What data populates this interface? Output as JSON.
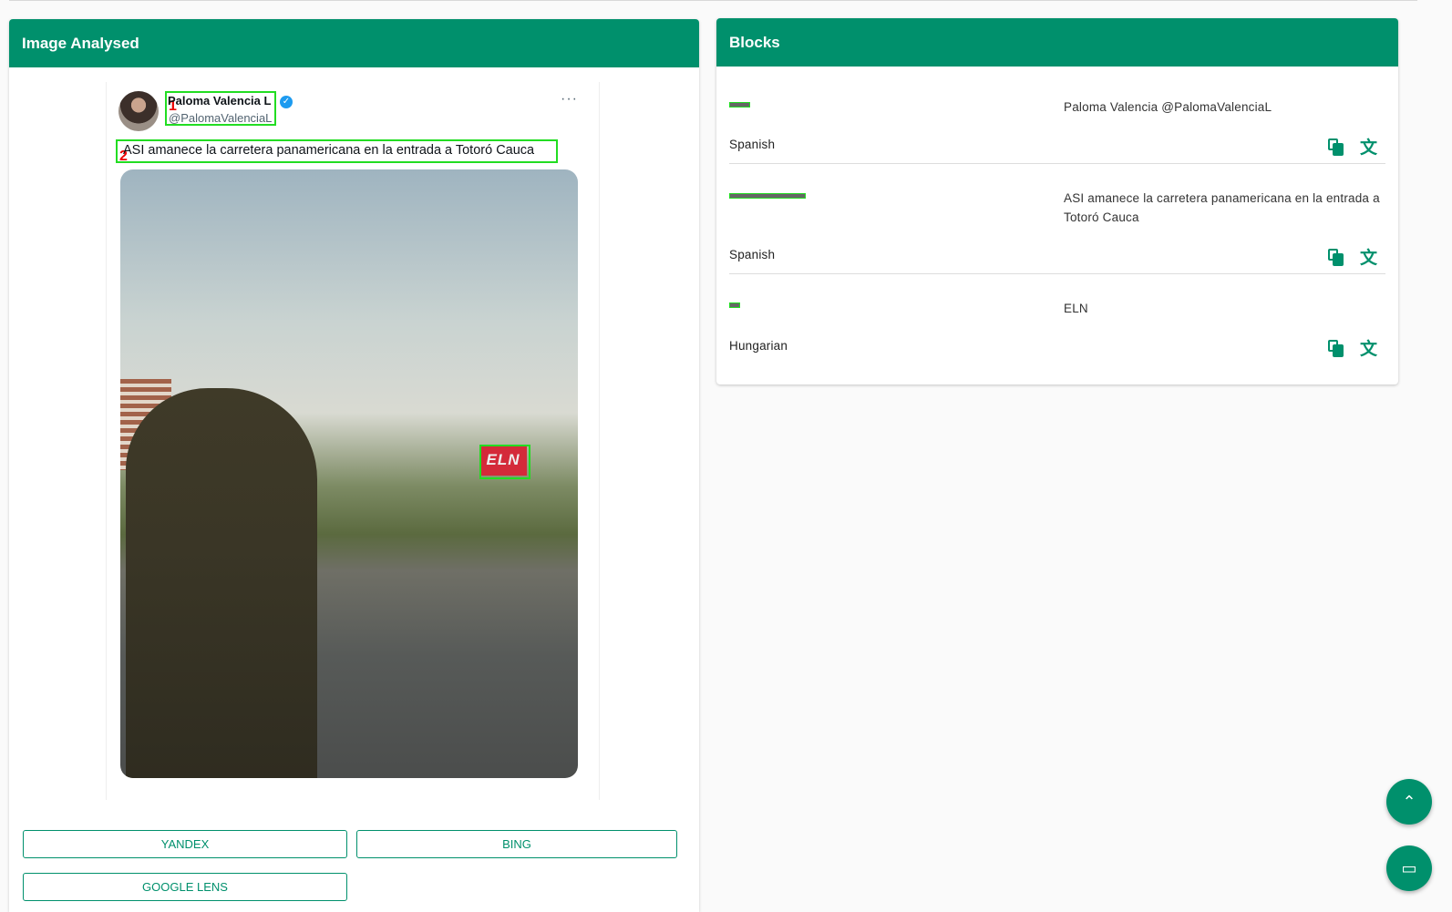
{
  "left_panel": {
    "title": "Image Analysed",
    "tweet": {
      "user_name": "Paloma Valencia L",
      "handle": "@PalomaValenciaL",
      "more": "···",
      "text": "ASI amanece la carretera panamericana en la entrada a Totoró Cauca",
      "photo_sign": "ELN",
      "box_labels": [
        "1",
        "2"
      ]
    },
    "buttons": [
      "YANDEX",
      "BING",
      "GOOGLE LENS"
    ]
  },
  "right_panel": {
    "title": "Blocks",
    "blocks": [
      {
        "text": "Paloma Valencia @PalomaValenciaL",
        "language": "Spanish"
      },
      {
        "text": "ASI amanece la carretera panamericana en la entrada a Totoró Cauca",
        "language": "Spanish"
      },
      {
        "text": "ELN",
        "language": "Hungarian"
      }
    ]
  },
  "icons": {
    "verified": "verified-badge-icon",
    "copy": "content-copy-icon",
    "translate": "translate-icon",
    "scroll_top": "chevron-up-icon",
    "chat": "chat-icon"
  },
  "colors": {
    "accent": "#00906c",
    "ocr_box": "#22dd22",
    "ocr_number": "#ee0000"
  }
}
